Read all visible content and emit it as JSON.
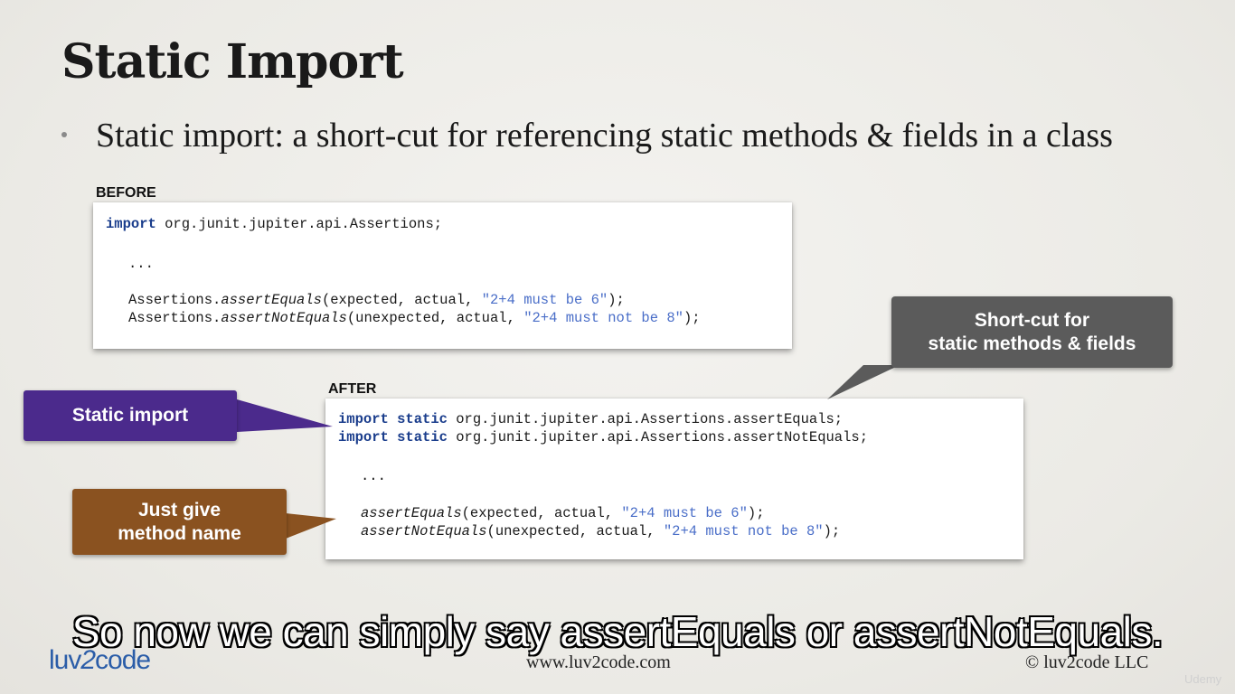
{
  "title": "Static Import",
  "bullet": "Static import: a short-cut for referencing static methods & fields in a class",
  "before": {
    "label": "BEFORE",
    "lines": {
      "l1_kw": "import",
      "l1_rest": " org.junit.jupiter.api.Assertions;",
      "l2": "...",
      "l3_a": "Assertions.",
      "l3_b": "assertEquals",
      "l3_c": "(expected, actual, ",
      "l3_d": "\"2+4 must be 6\"",
      "l3_e": ");",
      "l4_a": "Assertions.",
      "l4_b": "assertNotEquals",
      "l4_c": "(unexpected, actual, ",
      "l4_d": "\"2+4 must not be 8\"",
      "l4_e": ");"
    }
  },
  "after": {
    "label": "AFTER",
    "lines": {
      "l1_kw1": "import",
      "l1_kw2": "static",
      "l1_rest": " org.junit.jupiter.api.Assertions.assertEquals;",
      "l2_kw1": "import",
      "l2_kw2": "static",
      "l2_rest": " org.junit.jupiter.api.Assertions.assertNotEquals;",
      "l3": "...",
      "l4_a": "assertEquals",
      "l4_b": "(expected, actual, ",
      "l4_c": "\"2+4 must be 6\"",
      "l4_d": ");",
      "l5_a": "assertNotEquals",
      "l5_b": "(unexpected, actual, ",
      "l5_c": "\"2+4 must not be 8\"",
      "l5_d": ");"
    }
  },
  "callouts": {
    "shortcut": "Short-cut for\nstatic methods & fields",
    "static_import": "Static import",
    "method_name": "Just give\nmethod name"
  },
  "colors": {
    "shortcut_bg": "#5b5b5b",
    "static_import_bg": "#4b2a8c",
    "method_name_bg": "#8a5220",
    "keyword": "#1a3d8c",
    "string": "#4a6ec8"
  },
  "footer": {
    "logo_a": "luv",
    "logo_b": "2",
    "logo_c": "code",
    "url": "www.luv2code.com",
    "copyright": "© luv2code LLC"
  },
  "subtitle": "So now we can simply say assertEquals or assertNotEquals.",
  "watermark": "Udemy"
}
